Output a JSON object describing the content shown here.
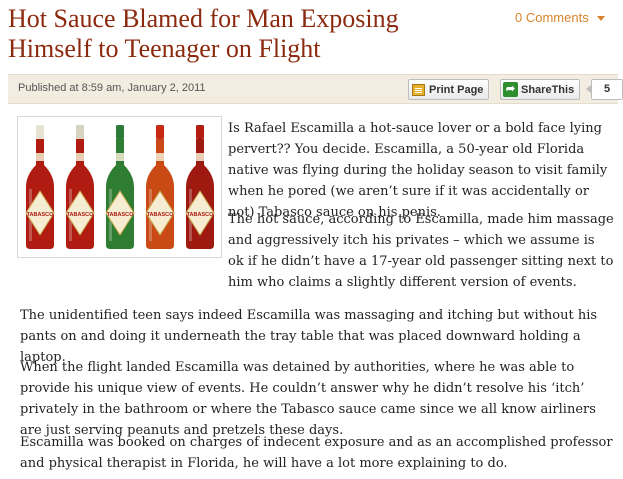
{
  "article": {
    "title": "Hot Sauce Blamed for Man Exposing Himself to Teenager on Flight",
    "comments_label": "0 Comments",
    "published": "Published at 8:59 am, January 2, 2011",
    "print_label": "Print Page",
    "share_label": "ShareThis",
    "share_count": "5",
    "image_labels": [
      "TABASCO",
      "TABASCO",
      "TABASCO",
      "TABASCO",
      "TABASCO"
    ],
    "paragraphs": [
      "Is Rafael Escamilla a hot-sauce lover or a bold face lying pervert?? You decide.  Escamilla, a 50-year old Florida native was flying during the holiday season to visit family when he pored (we aren’t sure if it was accidentally or not) Tabasco sauce on his penis.",
      "The hot sauce, according to Escamilla, made him massage and aggressively itch his privates – which we assume is ok if he didn’t have a 17-year old passenger sitting next to him who claims a slightly different version of events.",
      "The unidentified teen says indeed Escamilla was massaging and itching but without his pants on and doing it underneath the tray table that was placed downward holding a laptop.",
      "When the flight landed Escamilla was detained by authorities, where he was able to provide his unique view of events.  He couldn’t answer why he didn’t resolve his ‘itch’ privately in the bathroom or where the Tabasco sauce came since we all know airliners are just serving peanuts and pretzels these days.",
      "Escamilla was booked on charges of indecent exposure and as an accomplished professor and physical therapist in Florida, he will have a lot more explaining to do."
    ]
  },
  "colors": {
    "title": "#8b2a0e",
    "accent": "#d7832b",
    "metabar": "#f3ece0",
    "bottle_caps": [
      "#e8e2d2",
      "#d8d2c0",
      "#2b7a3a",
      "#c62a12",
      "#b31c10"
    ],
    "bottle_bodies": [
      "#b01c12",
      "#b01c12",
      "#2e7d32",
      "#c94a14",
      "#9e1a10"
    ]
  }
}
